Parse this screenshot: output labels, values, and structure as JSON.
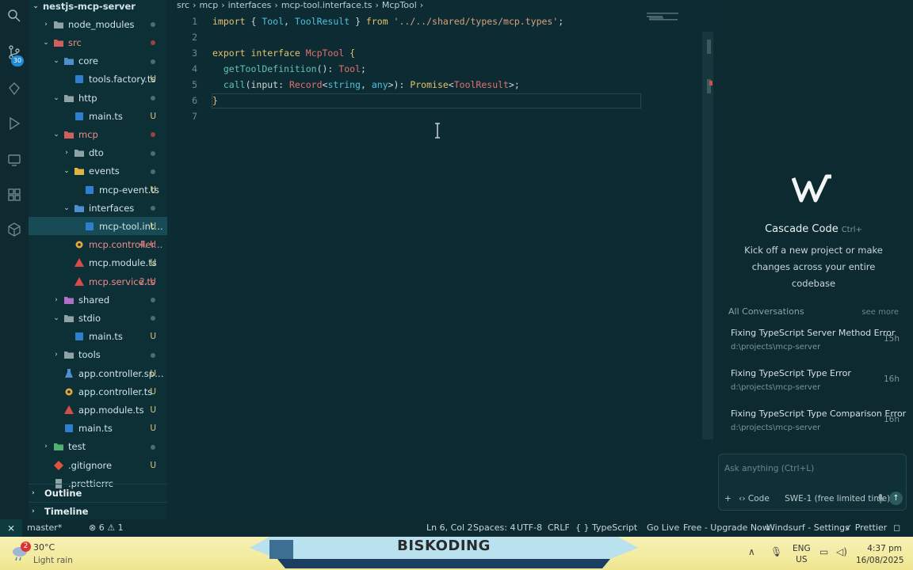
{
  "explorer": {
    "items": [
      {
        "label": "nestjs-mcp-server",
        "chev": "⌄",
        "depth": 0,
        "type": "root"
      },
      {
        "label": "node_modules",
        "chev": "›",
        "depth": 1,
        "type": "folder",
        "marker": "dot-grey"
      },
      {
        "label": "src",
        "chev": "⌄",
        "depth": 1,
        "type": "folder-red",
        "marker": "dot",
        "cls": "err"
      },
      {
        "label": "core",
        "chev": "⌄",
        "depth": 2,
        "type": "folder-blue",
        "marker": "dot-grey"
      },
      {
        "label": "tools.factory.ts",
        "depth": 3,
        "type": "ts",
        "status": "U"
      },
      {
        "label": "http",
        "chev": "⌄",
        "depth": 2,
        "type": "folder",
        "marker": "dot-grey"
      },
      {
        "label": "main.ts",
        "depth": 3,
        "type": "ts",
        "status": "U"
      },
      {
        "label": "mcp",
        "chev": "⌄",
        "depth": 2,
        "type": "folder-red",
        "marker": "dot",
        "cls": "err"
      },
      {
        "label": "dto",
        "chev": "›",
        "depth": 3,
        "type": "folder",
        "marker": "dot-grey"
      },
      {
        "label": "events",
        "chev": "⌄",
        "depth": 3,
        "type": "folder-yellow",
        "marker": "dot-grey"
      },
      {
        "label": "mcp-event.ts",
        "depth": 4,
        "type": "ts",
        "status": "U"
      },
      {
        "label": "interfaces",
        "chev": "⌄",
        "depth": 3,
        "type": "folder-blue",
        "marker": "dot-grey"
      },
      {
        "label": "mcp-tool.interf...",
        "depth": 4,
        "type": "ts",
        "status": "U",
        "selected": true
      },
      {
        "label": "mcp.controller...",
        "depth": 3,
        "type": "gear",
        "status": "4, U",
        "cls": "err",
        "statusCls": "red"
      },
      {
        "label": "mcp.module.ts",
        "depth": 3,
        "type": "ng",
        "status": "U"
      },
      {
        "label": "mcp.service.ts",
        "depth": 3,
        "type": "ng",
        "status": "2, U",
        "cls": "err",
        "statusCls": "red"
      },
      {
        "label": "shared",
        "chev": "›",
        "depth": 2,
        "type": "folder-purple",
        "marker": "dot-grey"
      },
      {
        "label": "stdio",
        "chev": "⌄",
        "depth": 2,
        "type": "folder",
        "marker": "dot-grey"
      },
      {
        "label": "main.ts",
        "depth": 3,
        "type": "ts",
        "status": "U"
      },
      {
        "label": "tools",
        "chev": "›",
        "depth": 2,
        "type": "folder",
        "marker": "dot-grey"
      },
      {
        "label": "app.controller.spe...",
        "depth": 2,
        "type": "flask",
        "status": "U"
      },
      {
        "label": "app.controller.ts",
        "depth": 2,
        "type": "gear",
        "status": "U"
      },
      {
        "label": "app.module.ts",
        "depth": 2,
        "type": "ng",
        "status": "U"
      },
      {
        "label": "main.ts",
        "depth": 2,
        "type": "ts",
        "status": "U"
      },
      {
        "label": "test",
        "chev": "›",
        "depth": 1,
        "type": "folder-green",
        "marker": "dot-grey"
      },
      {
        "label": ".gitignore",
        "depth": 1,
        "type": "git",
        "status": "U"
      },
      {
        "label": ".prettierrc",
        "depth": 1,
        "type": "file",
        "status": ""
      }
    ],
    "outline": "Outline",
    "timeline": "Timeline"
  },
  "activity_badge": "30",
  "breadcrumb": [
    "src",
    "›",
    "mcp",
    "›",
    "interfaces",
    "›",
    "mcp-tool.interface.ts",
    "›",
    "McpTool",
    "›"
  ],
  "code": [
    {
      "n": "1",
      "tokens": [
        [
          "kw",
          "import"
        ],
        [
          "pl",
          " { "
        ],
        [
          "ty",
          "Tool"
        ],
        [
          "pl",
          ", "
        ],
        [
          "ty",
          "ToolResult"
        ],
        [
          "pl",
          " } "
        ],
        [
          "kw",
          "from"
        ],
        [
          "pl",
          " "
        ],
        [
          "str",
          "'../../shared/types/mcp.types'"
        ],
        [
          "pl",
          ";"
        ]
      ]
    },
    {
      "n": "2",
      "tokens": []
    },
    {
      "n": "3",
      "tokens": [
        [
          "kw",
          "export"
        ],
        [
          "pl",
          " "
        ],
        [
          "kw",
          "interface"
        ],
        [
          "pl",
          " "
        ],
        [
          "cls",
          "McpTool"
        ],
        [
          "pl",
          " "
        ],
        [
          "kw",
          "{"
        ]
      ]
    },
    {
      "n": "4",
      "tokens": [
        [
          "pl",
          "  "
        ],
        [
          "fn",
          "getToolDefinition"
        ],
        [
          "pl",
          "(): "
        ],
        [
          "cls",
          "Tool"
        ],
        [
          "pl",
          ";"
        ]
      ]
    },
    {
      "n": "5",
      "tokens": [
        [
          "pl",
          "  "
        ],
        [
          "fn",
          "call"
        ],
        [
          "pl",
          "(input: "
        ],
        [
          "cls",
          "Record"
        ],
        [
          "pl",
          "<"
        ],
        [
          "ty",
          "string"
        ],
        [
          "pl",
          ", "
        ],
        [
          "ty",
          "any"
        ],
        [
          "pl",
          ">): "
        ],
        [
          "kw",
          "Promise"
        ],
        [
          "pl",
          "<"
        ],
        [
          "cls",
          "ToolResult"
        ],
        [
          "pl",
          ">;"
        ]
      ]
    },
    {
      "n": "6",
      "tokens": [
        [
          "kw",
          "}"
        ]
      ]
    },
    {
      "n": "7",
      "tokens": []
    }
  ],
  "panel": {
    "title": "Cascade Code",
    "shortcut": "Ctrl+",
    "subtitle": "Kick off a new project or make changes across your entire codebase",
    "conversations_header": "All Conversations",
    "see_more": "see more",
    "conversations": [
      {
        "title": "Fixing TypeScript Server Method Error",
        "path": "d:\\projects\\mcp-server",
        "age": "15h"
      },
      {
        "title": "Fixing TypeScript Type Error",
        "path": "d:\\projects\\mcp-server",
        "age": "16h"
      },
      {
        "title": "Fixing TypeScript Type Comparison Error",
        "path": "d:\\projects\\mcp-server",
        "age": "16h"
      }
    ],
    "ask_placeholder": "Ask anything (Ctrl+L)",
    "add": "+",
    "mode": "‹› Code",
    "model": "SWE-1 (free limited time)"
  },
  "status": {
    "branch": "master*",
    "errors": "⊗ 6 ⚠ 1",
    "position": "Ln 6, Col 2",
    "spaces": "Spaces: 4",
    "encoding": "UTF-8",
    "eol": "CRLF",
    "language": "{ } TypeScript",
    "golive": "Go Live",
    "upgrade": "Free - Upgrade Now",
    "windsurf": "Windsurf - Settings",
    "prettier": "✓ Prettier"
  },
  "taskbar": {
    "badge": "2",
    "temp": "30°C",
    "condition": "Light rain",
    "banner": "BISKODING",
    "lang1": "ENG",
    "lang2": "US",
    "time": "4:37 pm",
    "date": "16/08/2025"
  },
  "colors": {
    "accent": "#1e8bd6",
    "error": "#e37b7b",
    "modified": "#d7c77a"
  }
}
